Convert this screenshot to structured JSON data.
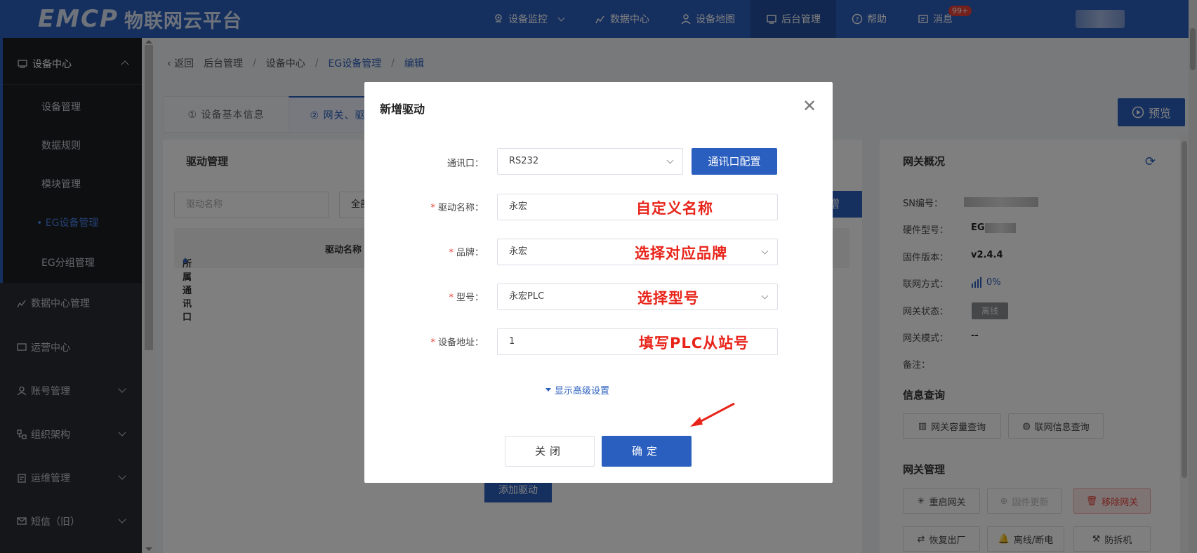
{
  "header": {
    "logo_mark": "EMCP",
    "logo_text": "物联网云平台",
    "nav": [
      {
        "label": "设备监控",
        "icon": "location-icon"
      },
      {
        "label": "数据中心",
        "icon": "chart-icon"
      },
      {
        "label": "设备地图",
        "icon": "user-pin-icon"
      },
      {
        "label": "后台管理",
        "icon": "admin-icon"
      },
      {
        "label": "帮助",
        "icon": "help-icon"
      },
      {
        "label": "消息",
        "icon": "message-icon"
      }
    ],
    "message_badge": "99+"
  },
  "sidebar": {
    "group_device": "设备中心",
    "sub_items": [
      "设备管理",
      "数据规则",
      "模块管理",
      "EG设备管理",
      "EG分组管理"
    ],
    "groups": [
      "数据中心管理",
      "运营中心",
      "账号管理",
      "组织架构",
      "运维管理",
      "短信（旧）"
    ]
  },
  "breadcrumb": {
    "back": "返回",
    "items": [
      "后台管理",
      "设备中心",
      "EG设备管理",
      "编辑"
    ]
  },
  "tabs": {
    "tab1": "① 设备基本信息",
    "tab2": "② 网关、驱"
  },
  "preview_label": "预览",
  "drive_panel": {
    "title": "驱动管理",
    "filter_placeholder": "驱动名称",
    "filter2": "全部",
    "add_right": "增",
    "col_port": "所属通讯口",
    "col_name": "驱动名称",
    "add_drive": "添加驱动"
  },
  "gateway": {
    "title": "网关概况",
    "sn_label": "SN编号：",
    "hw_label": "硬件型号：",
    "hw_value": "EG",
    "fw_label": "固件版本：",
    "fw_value": "v2.4.4",
    "net_label": "联网方式：",
    "net_value": "0%",
    "status_label": "网关状态：",
    "status_value": "离线",
    "mode_label": "网关模式：",
    "mode_value": "--",
    "note_label": "备注：",
    "info_title": "信息查询",
    "btn_capacity": "网关容量查询",
    "btn_netinfo": "联网信息查询",
    "mgmt_title": "网关管理",
    "btn_restart": "重启网关",
    "btn_firmware": "固件更新",
    "btn_remove": "移除网关",
    "btn_reset": "恢复出厂",
    "btn_offline": "离线/断电",
    "btn_tamper": "防拆机"
  },
  "modal": {
    "title": "新增驱动",
    "port_label": "通讯口：",
    "port_value": "RS232",
    "port_config": "通讯口配置",
    "name_label": "驱动名称：",
    "name_value": "永宏",
    "name_annot": "自定义名称",
    "brand_label": "品牌：",
    "brand_value": "永宏",
    "brand_annot": "选择对应品牌",
    "model_label": "型号：",
    "model_value": "永宏PLC",
    "model_annot": "选择型号",
    "addr_label": "设备地址：",
    "addr_value": "1",
    "addr_annot": "填写PLC从站号",
    "advanced": "显示高级设置",
    "cancel": "关闭",
    "ok": "确定"
  },
  "colors": {
    "primary": "#2b5fbf",
    "annotation": "#e8241a",
    "sidebar_bg": "#2a2d33"
  }
}
